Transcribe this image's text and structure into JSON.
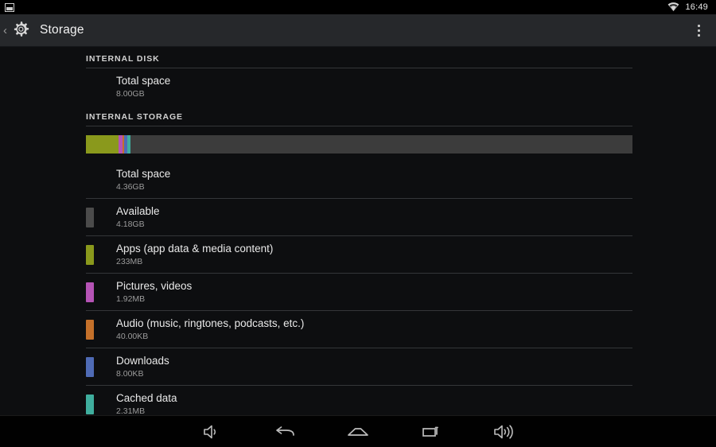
{
  "statusbar": {
    "screenshot_icon": "screenshot-icon",
    "wifi_icon": "wifi-icon",
    "time": "16:49"
  },
  "actionbar": {
    "up_icon": "back-chevron-icon",
    "app_icon": "settings-gear-icon",
    "title": "Storage",
    "overflow_icon": "overflow-menu-icon"
  },
  "sections": [
    {
      "header": "INTERNAL DISK",
      "rows": [
        {
          "title": "Total space",
          "sub": "8.00GB",
          "color": null
        }
      ]
    },
    {
      "header": "INTERNAL STORAGE",
      "rows": [
        {
          "title": "Total space",
          "sub": "4.36GB",
          "color": null
        },
        {
          "title": "Available",
          "sub": "4.18GB",
          "color": "#4b4b4b"
        },
        {
          "title": "Apps (app data & media content)",
          "sub": "233MB",
          "color": "#8a991c"
        },
        {
          "title": "Pictures, videos",
          "sub": "1.92MB",
          "color": "#b council"
        }
      ]
    }
  ],
  "storage_rows": [
    {
      "title": "Total space",
      "sub": "4.36GB",
      "color": null
    },
    {
      "title": "Available",
      "sub": "4.18GB",
      "color": "#4b4b4b"
    },
    {
      "title": "Apps (app data & media content)",
      "sub": "233MB",
      "color": "#8a991c"
    },
    {
      "title": "Pictures, videos",
      "sub": "1.92MB",
      "color": "#b553b5"
    },
    {
      "title": "Audio (music, ringtones, podcasts, etc.)",
      "sub": "40.00KB",
      "color": "#c4702a"
    },
    {
      "title": "Downloads",
      "sub": "8.00KB",
      "color": "#4f6bb5"
    },
    {
      "title": "Cached data",
      "sub": "2.31MB",
      "color": "#3fae9e"
    }
  ],
  "usage_bar": {
    "free_color": "#3c3c3c",
    "segments": [
      {
        "name": "Apps",
        "color": "#8a991c",
        "percent": 5.9
      },
      {
        "name": "Pictures, videos",
        "color": "#b553b5",
        "percent": 0.75
      },
      {
        "name": "Audio",
        "color": "#c4702a",
        "percent": 0.4
      },
      {
        "name": "Downloads",
        "color": "#4f6bb5",
        "percent": 0.5
      },
      {
        "name": "Cached data",
        "color": "#3fae9e",
        "percent": 0.6
      }
    ]
  },
  "navbar": {
    "buttons": [
      {
        "icon": "volume-down-icon",
        "label": "Volume down"
      },
      {
        "icon": "back-icon",
        "label": "Back"
      },
      {
        "icon": "home-icon",
        "label": "Home"
      },
      {
        "icon": "recents-icon",
        "label": "Recent apps"
      },
      {
        "icon": "volume-up-icon",
        "label": "Volume up"
      }
    ]
  }
}
